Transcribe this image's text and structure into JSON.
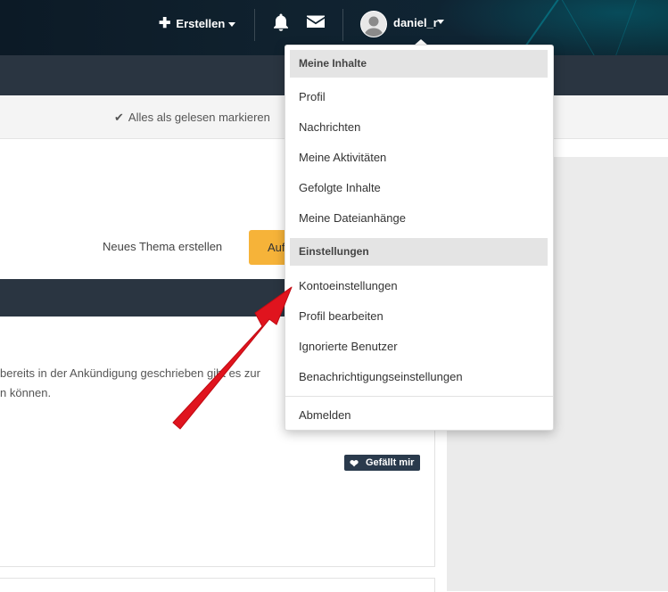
{
  "header": {
    "create_label": "Erstellen",
    "username": "daniel_r"
  },
  "toolbar": {
    "mark_read_label": "Alles als gelesen markieren"
  },
  "forum": {
    "new_thread_label": "Neues Thema erstellen",
    "orange_button_label": "Auf"
  },
  "post": {
    "line1": "bereits in der Ankündigung geschrieben gibt es zur",
    "line2": "n können.",
    "like_label": "Gefällt mir"
  },
  "dropdown": {
    "section1_header": "Meine Inhalte",
    "section1_items": [
      "Profil",
      "Nachrichten",
      "Meine Aktivitäten",
      "Gefolgte Inhalte",
      "Meine Dateianhänge"
    ],
    "section2_header": "Einstellungen",
    "section2_items": [
      "Kontoeinstellungen",
      "Profil bearbeiten",
      "Ignorierte Benutzer",
      "Benachrichtigungseinstellungen"
    ],
    "logout_label": "Abmelden"
  },
  "colors": {
    "header_bg": "#0f2230",
    "dark_band": "#2a3541",
    "accent_orange": "#f6b339",
    "arrow_red": "#e0141e"
  },
  "icons": [
    "plus-icon",
    "bell-icon",
    "mail-icon",
    "avatar-icon",
    "check-icon",
    "heart-icon",
    "chevron-down-icon"
  ]
}
